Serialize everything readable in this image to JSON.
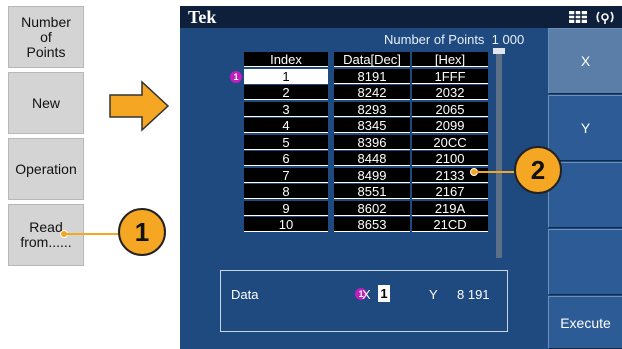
{
  "left_menu": [
    {
      "label": "Number\nof\nPoints"
    },
    {
      "label": "New"
    },
    {
      "label": "Operation"
    },
    {
      "label": "Read\nfrom......"
    }
  ],
  "callouts": [
    "1",
    "2"
  ],
  "screen": {
    "brand": "Tek",
    "number_of_points_label": "Number of Points",
    "number_of_points_value": "1 000",
    "columns": [
      "Index",
      "Data[Dec]",
      "[Hex]"
    ],
    "marker": "1",
    "rows": [
      [
        "1",
        "8191",
        "1FFF"
      ],
      [
        "2",
        "8242",
        "2032"
      ],
      [
        "3",
        "8293",
        "2065"
      ],
      [
        "4",
        "8345",
        "2099"
      ],
      [
        "5",
        "8396",
        "20CC"
      ],
      [
        "6",
        "8448",
        "2100"
      ],
      [
        "7",
        "8499",
        "2133"
      ],
      [
        "8",
        "8551",
        "2167"
      ],
      [
        "9",
        "8602",
        "219A"
      ],
      [
        "10",
        "8653",
        "21CD"
      ]
    ],
    "data_box": {
      "label": "Data",
      "marker": "1",
      "x_label": "X",
      "x_value": "1",
      "y_label": "Y",
      "y_value": "8 191"
    },
    "softkeys": [
      "X",
      "Y",
      "",
      "",
      "Execute"
    ]
  },
  "colors": {
    "screen_bg": "#1e4a80",
    "callout": "#f5a623",
    "marker": "#c01ec0"
  }
}
